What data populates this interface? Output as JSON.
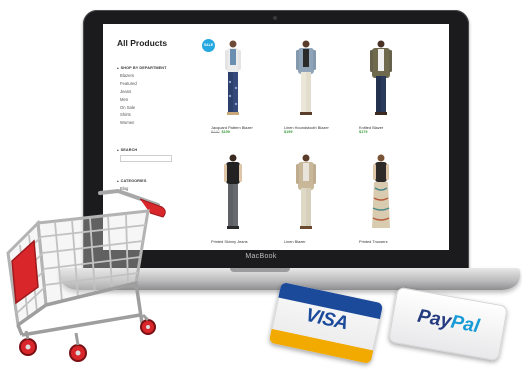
{
  "laptop": {
    "brand_label": "MacBook"
  },
  "store": {
    "page_title": "All Products",
    "badge": "SALE",
    "sections": {
      "shop_by_department": "SHOP BY DEPARTMENT",
      "search": "SEARCH",
      "categories": "CATEGORIES"
    },
    "departments": [
      "Blazers",
      "Featured",
      "Jeans",
      "Men",
      "On Sale",
      "Shirts",
      "Women"
    ],
    "category_first": "Blog",
    "products": [
      {
        "name": "Jacquard Pattern Blazer",
        "old_price": "$210",
        "price": "$199"
      },
      {
        "name": "Linen Houndstooth Blazer",
        "old_price": "",
        "price": "$199"
      },
      {
        "name": "Knitted Blazer",
        "old_price": "",
        "price": "$179"
      },
      {
        "name": "Printed Skinny Jeans",
        "old_price": "",
        "price": ""
      },
      {
        "name": "Linen Blazer",
        "old_price": "",
        "price": ""
      },
      {
        "name": "Printed Trousers",
        "old_price": "",
        "price": ""
      }
    ]
  },
  "payment": {
    "visa_label": "VISA",
    "paypal_label_a": "Pay",
    "paypal_label_b": "Pal"
  },
  "colors": {
    "sale_badge": "#25a8e0",
    "price_green": "#3a9b3a",
    "cart_red": "#d9262a",
    "visa_blue": "#1b4a9b",
    "visa_gold": "#f2a900"
  }
}
